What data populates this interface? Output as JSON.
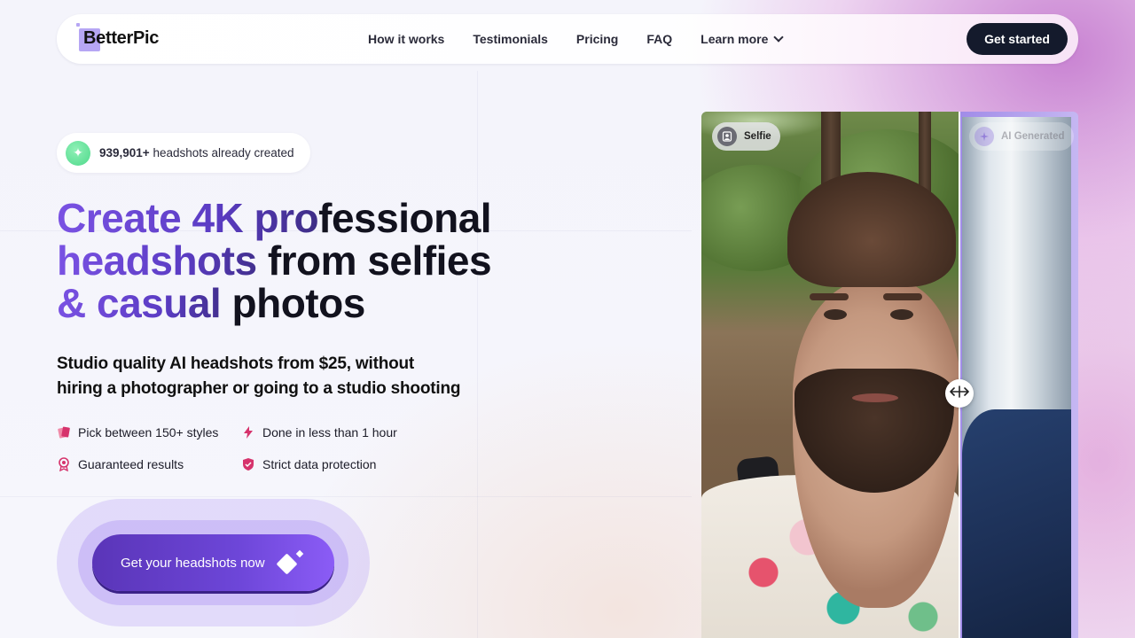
{
  "nav": {
    "logo_text": "BetterPic",
    "links": [
      {
        "label": "How it works"
      },
      {
        "label": "Testimonials"
      },
      {
        "label": "Pricing"
      },
      {
        "label": "FAQ"
      },
      {
        "label": "Learn more",
        "icon": "chevron-down-icon"
      }
    ],
    "cta_label": "Get started"
  },
  "badge": {
    "count": "939,901+",
    "text": " headshots already created",
    "icon": "sparkle-icon"
  },
  "hero": {
    "headline": {
      "line1_accent": "Create 4K pro",
      "line1_dark": "fessional",
      "line2_accent": "headshots ",
      "line2_dark": "from selfies",
      "line3_accent": "& casual ",
      "line3_dark": "photos"
    },
    "subheadline_line1": "Studio quality AI headshots from $25, without",
    "subheadline_line2": "hiring a photographer or going to a studio shooting",
    "features": [
      {
        "label": "Pick between 150+ styles",
        "icon": "cards-icon"
      },
      {
        "label": "Done in less than 1 hour",
        "icon": "lightning-icon"
      },
      {
        "label": "Guaranteed results",
        "icon": "award-icon"
      },
      {
        "label": "Strict data protection",
        "icon": "shield-icon"
      }
    ],
    "cta_label": "Get your headshots now"
  },
  "comparison": {
    "left_label": "Selfie",
    "right_label": "AI Generated",
    "handle_icon": "drag-arrows-icon"
  },
  "colors": {
    "accent_purple": "#6d46d8",
    "dark_button": "#141a2c",
    "feature_pink": "#d6336c",
    "badge_green": "#4fd98b"
  }
}
